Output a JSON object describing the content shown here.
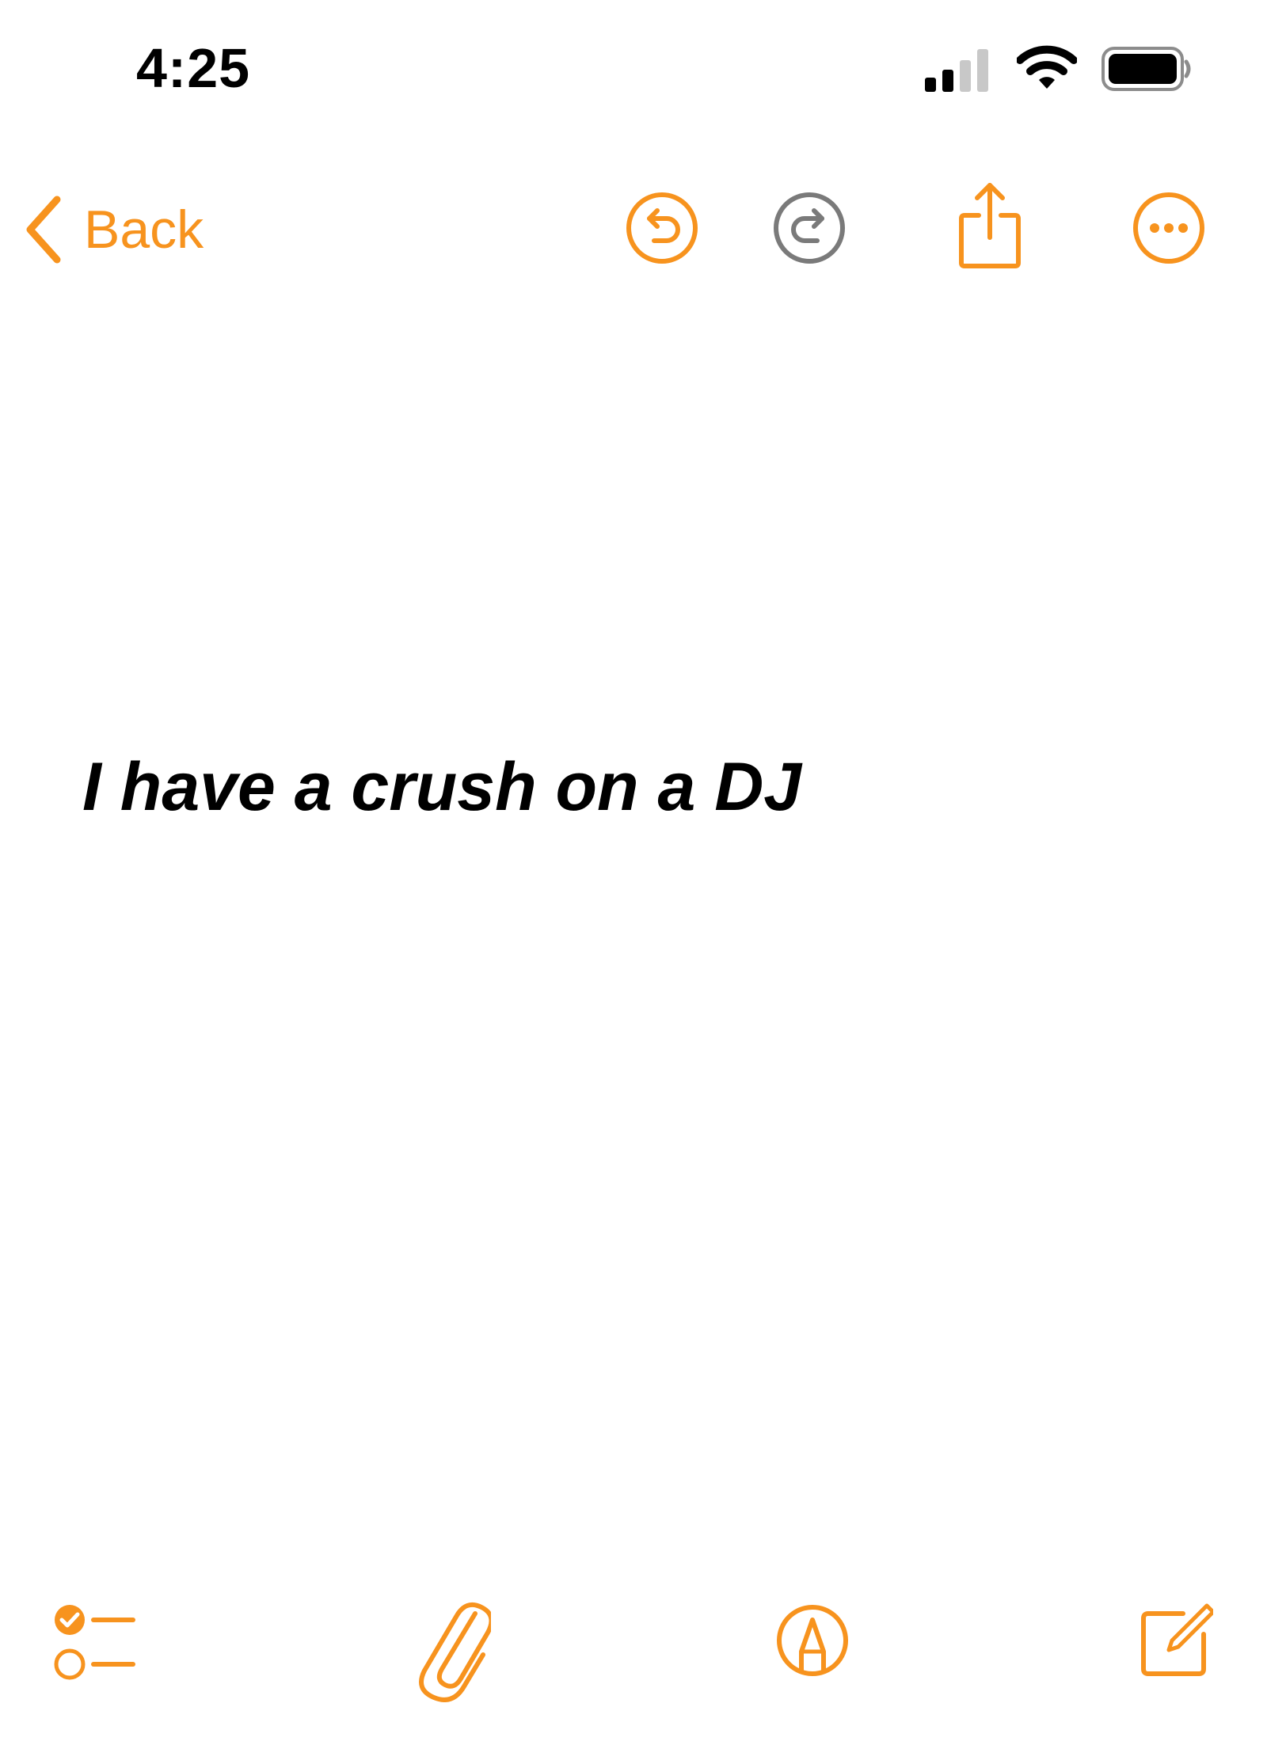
{
  "status_bar": {
    "time": "4:25",
    "icons": [
      "cellular-signal-icon",
      "wifi-icon",
      "battery-icon"
    ]
  },
  "nav_bar": {
    "back_label": "Back",
    "icons": [
      "undo-icon",
      "redo-icon",
      "share-icon",
      "more-icon"
    ]
  },
  "note": {
    "text": "I have a crush on a DJ"
  },
  "bottom_toolbar": {
    "icons": [
      "checklist-icon",
      "attachment-icon",
      "markup-icon",
      "compose-icon"
    ]
  },
  "colors": {
    "accent": "#F7931E",
    "disabled": "#7A7A7A",
    "text": "#000000",
    "background": "#FFFFFF"
  }
}
